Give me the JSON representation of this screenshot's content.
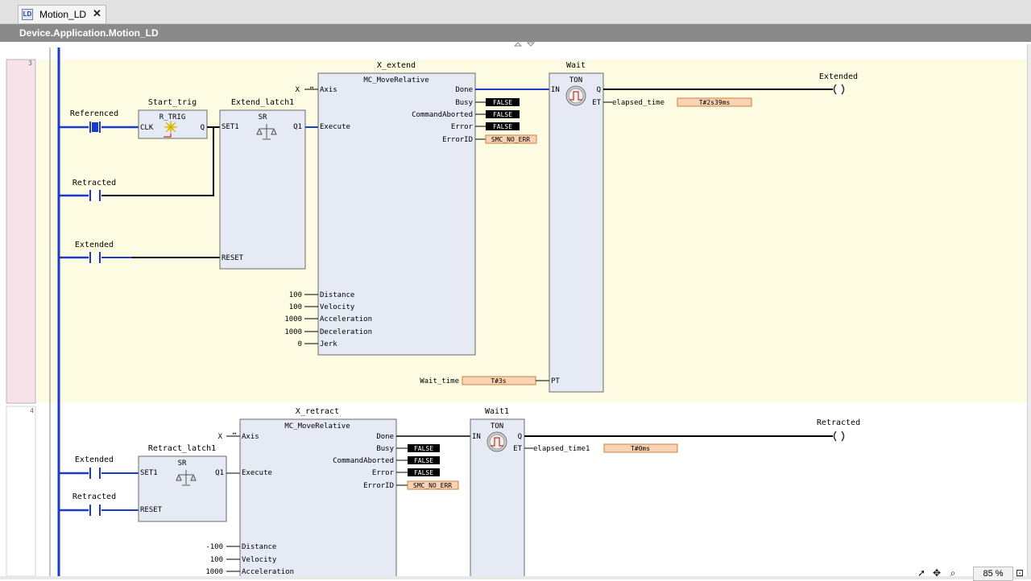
{
  "tab": {
    "title": "Motion_LD",
    "icon": "ladder-diagram-icon"
  },
  "path": {
    "title": "Device.Application.Motion_LD"
  },
  "zoom": {
    "label": "85 %"
  },
  "rungs": {
    "rung3_number": "3",
    "rung4_number": "4"
  },
  "r3": {
    "c_referenced": "Referenced",
    "c_retracted": "Retracted",
    "c_extended": "Extended",
    "coil_extended": "Extended",
    "start_trig": {
      "instance": "Start_trig",
      "type": "R_TRIG",
      "clk": "CLK",
      "q": "Q"
    },
    "extend_latch": {
      "instance": "Extend_latch1",
      "type": "SR",
      "set1": "SET1",
      "q1": "Q1",
      "reset": "RESET"
    },
    "x_extend": {
      "instance": "X_extend",
      "type": "MC_MoveRelative",
      "in_axis": "Axis",
      "in_execute": "Execute",
      "in_distance": "Distance",
      "in_velocity": "Velocity",
      "in_acceleration": "Acceleration",
      "in_deceleration": "Deceleration",
      "in_jerk": "Jerk",
      "out_done": "Done",
      "out_busy": "Busy",
      "out_commandaborted": "CommandAborted",
      "out_error": "Error",
      "out_errorid": "ErrorID",
      "axis_var": "X",
      "distance_val": "100",
      "velocity_val": "100",
      "acceleration_val": "1000",
      "deceleration_val": "1000",
      "jerk_val": "0",
      "busy_val": "FALSE",
      "commandaborted_val": "FALSE",
      "error_val": "FALSE",
      "errorid_val": "SMC_NO_ERR"
    },
    "wait": {
      "instance": "Wait",
      "type": "TON",
      "in": "IN",
      "q": "Q",
      "et": "ET",
      "pt": "PT",
      "et_var": "elapsed_time",
      "et_val": "T#2s39ms",
      "pt_var": "Wait_time",
      "pt_val": "T#3s"
    }
  },
  "r4": {
    "c_extended": "Extended",
    "c_retracted": "Retracted",
    "coil_retracted": "Retracted",
    "retract_latch": {
      "instance": "Retract_latch1",
      "type": "SR",
      "set1": "SET1",
      "q1": "Q1",
      "reset": "RESET"
    },
    "x_retract": {
      "instance": "X_retract",
      "type": "MC_MoveRelative",
      "in_axis": "Axis",
      "in_execute": "Execute",
      "in_distance": "Distance",
      "in_velocity": "Velocity",
      "in_acceleration": "Acceleration",
      "out_done": "Done",
      "out_busy": "Busy",
      "out_commandaborted": "CommandAborted",
      "out_error": "Error",
      "out_errorid": "ErrorID",
      "axis_var": "X",
      "distance_val": "-100",
      "velocity_val": "100",
      "acceleration_val": "1000",
      "busy_val": "FALSE",
      "commandaborted_val": "FALSE",
      "error_val": "FALSE",
      "errorid_val": "SMC_NO_ERR"
    },
    "wait1": {
      "instance": "Wait1",
      "type": "TON",
      "in": "IN",
      "q": "Q",
      "et": "ET",
      "et_var": "elapsed_time1",
      "et_val": "T#0ms"
    }
  },
  "colors": {
    "rung_bg": "#fdfbe1",
    "fb_fill": "#e6eaf4",
    "value_fill": "#f9d3b3",
    "bool_fill": "#000000",
    "rail": "#1a3bc9",
    "active_wire": "#1a3bc9"
  },
  "icons": {
    "pointer": "pointer-icon",
    "pan": "move-icon",
    "zoom": "zoom-icon",
    "zoom_fit": "zoom-fit-icon"
  }
}
